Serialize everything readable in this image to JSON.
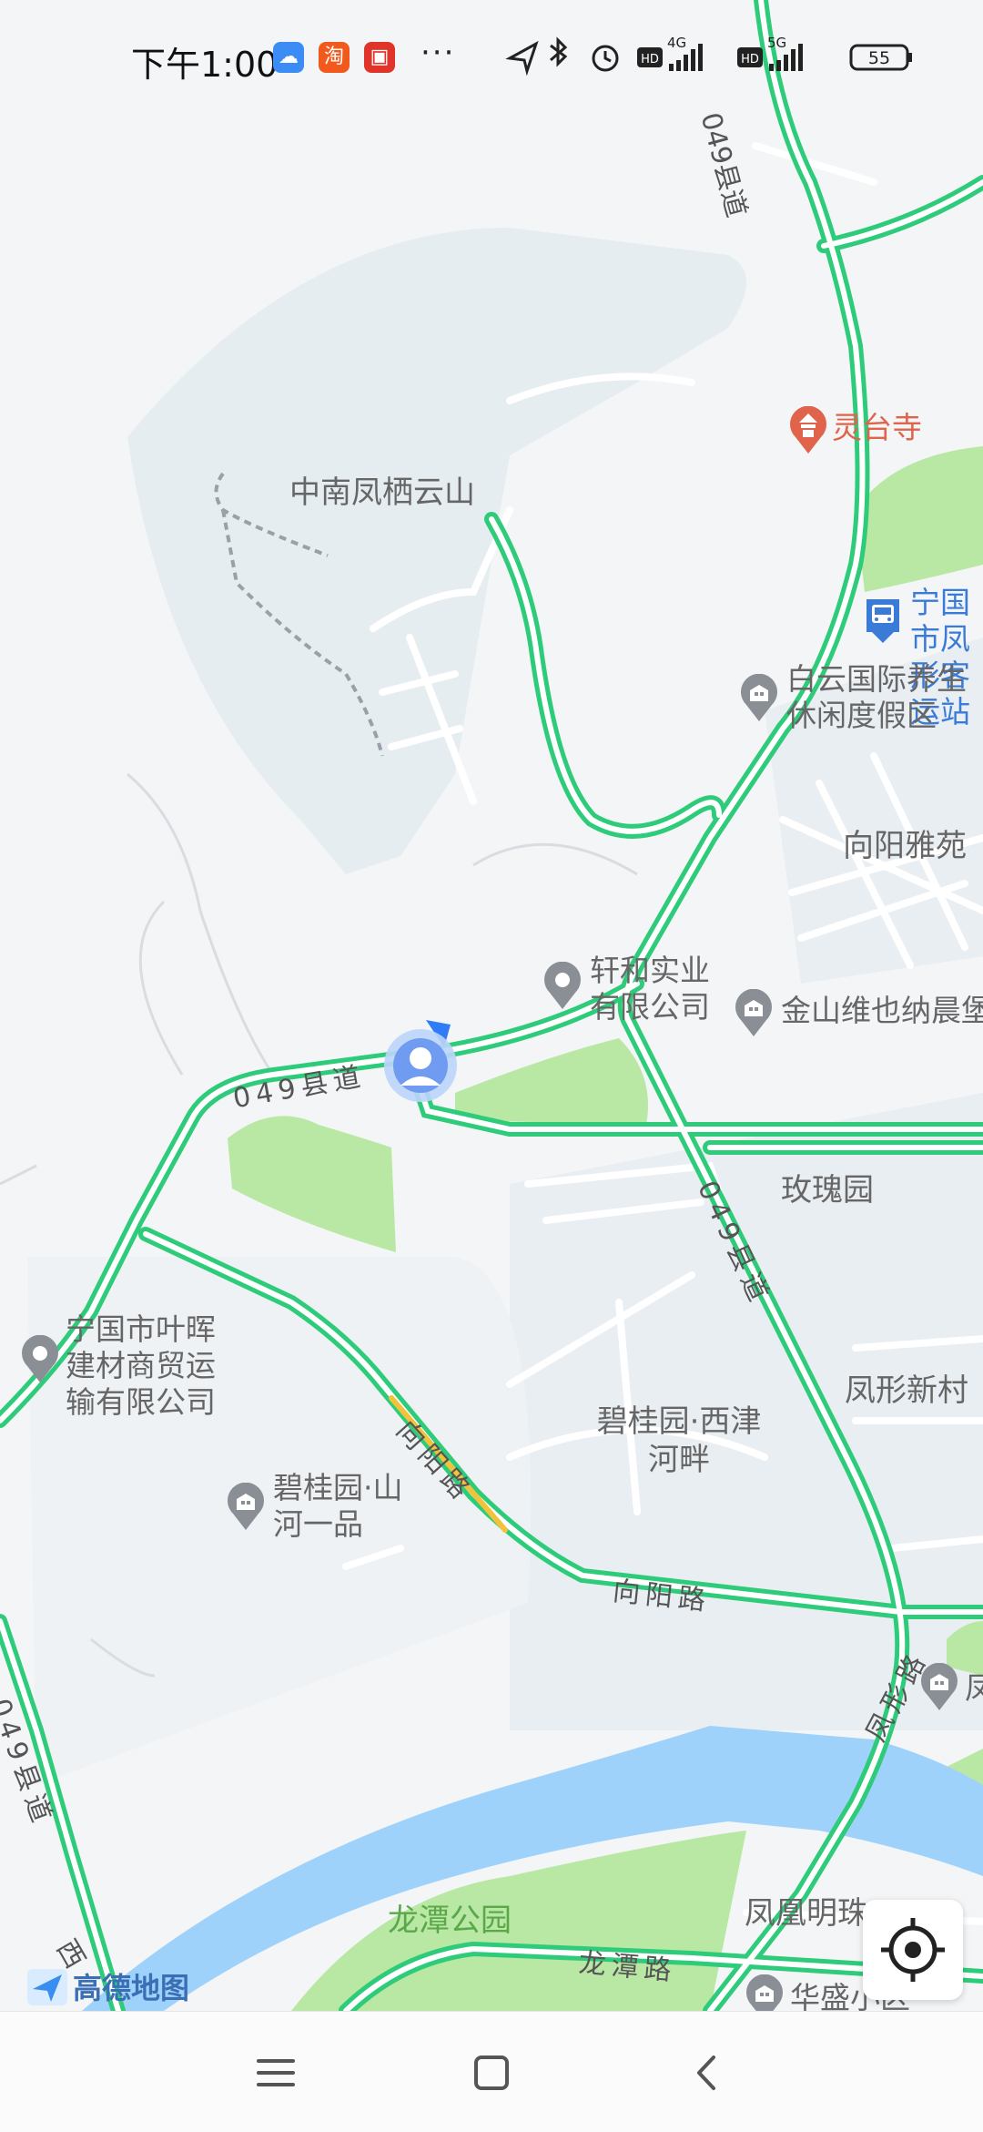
{
  "status_bar": {
    "time": "下午1:00",
    "apps": [
      {
        "name": "weather-app-icon",
        "color": "#3b8cf5",
        "glyph": "☁"
      },
      {
        "name": "taobao-app-icon",
        "color": "#f2591c",
        "glyph": "淘"
      },
      {
        "name": "shop-app-icon",
        "color": "#e0342a",
        "glyph": "▣"
      }
    ],
    "more": "···",
    "network_1": "4G",
    "network_2": "5G",
    "hd_1": "HD",
    "hd_2": "HD",
    "battery": "55"
  },
  "map": {
    "places": [
      {
        "id": "zhongnan",
        "text": "中南凤栖云山"
      },
      {
        "id": "xiangyang-yayuan",
        "text": "向阳雅苑"
      },
      {
        "id": "meigui",
        "text": "玫瑰园"
      },
      {
        "id": "fengxing-xincun",
        "text": "凤形新村"
      },
      {
        "id": "biguiyuan-xijin",
        "text": "碧桂园·西津河畔"
      },
      {
        "id": "fenghuang",
        "text": "凤凰明珠"
      }
    ],
    "pois": [
      {
        "id": "lingtai-temple",
        "text": "灵台寺",
        "icon": "temple-icon"
      },
      {
        "id": "bus-station",
        "text": "宁国市凤形客运站",
        "icon": "bus-station-icon"
      },
      {
        "id": "baiyun-resort",
        "text": "白云国际养生休闲度假区",
        "icon": "building-icon"
      },
      {
        "id": "xuanhe",
        "text": "轩和实业有限公司",
        "icon": "location-pin-icon"
      },
      {
        "id": "jinshan",
        "text": "金山维也纳晨堡",
        "icon": "building-icon"
      },
      {
        "id": "yehui",
        "text": "宁国市叶晖建材商贸运输有限公司",
        "icon": "location-pin-icon"
      },
      {
        "id": "biguiyuan-shanhe",
        "text": "碧桂园·山河一品",
        "icon": "building-icon"
      },
      {
        "id": "feng-right",
        "text": "凤",
        "icon": "building-icon"
      },
      {
        "id": "huasheng",
        "text": "华盛小区",
        "icon": "building-icon"
      }
    ],
    "parks": [
      {
        "id": "longtan-park",
        "text": "龙潭公园"
      }
    ],
    "roads": [
      {
        "id": "road-049-top",
        "text": "049县道"
      },
      {
        "id": "road-049-left",
        "text": "049县道"
      },
      {
        "id": "road-049-mid",
        "text": "049县道"
      },
      {
        "id": "road-049-bottom",
        "text": "049县道"
      },
      {
        "id": "xiangyang-road-1",
        "text": "向阳路"
      },
      {
        "id": "xiangyang-road-2",
        "text": "向阳路"
      },
      {
        "id": "fengxing-road",
        "text": "凤形路"
      },
      {
        "id": "longtan-road",
        "text": "龙潭路"
      },
      {
        "id": "xi-road",
        "text": "西"
      }
    ],
    "colors": {
      "road": "#2ecc7a",
      "water": "#9fd2fa",
      "park": "#b9e8a4",
      "poi_red": "#e0634c",
      "poi_gray": "#8a8f96",
      "bus_blue": "#3b7bd8",
      "bus_text": "#3b7bd8"
    }
  },
  "watermark": {
    "brand": "高德地图"
  },
  "locate_button": {
    "label": "定位"
  },
  "nav_bar": {
    "menu": "menu",
    "home": "home",
    "back": "back"
  }
}
